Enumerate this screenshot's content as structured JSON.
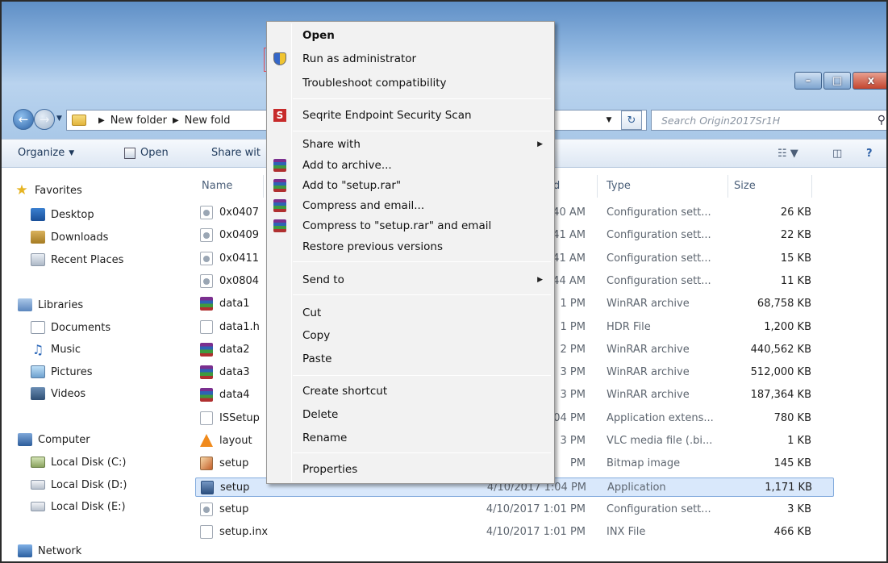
{
  "window": {
    "controls": {
      "minimize": "–",
      "maximize": "□",
      "close": "x"
    }
  },
  "address": {
    "crumbs": [
      "New folder",
      "New fold"
    ],
    "search_placeholder": "Search Origin2017Sr1H"
  },
  "toolbar": {
    "organize_label": "Organize",
    "open_label": "Open",
    "share_label": "Share wit"
  },
  "nav": {
    "favorites": "Favorites",
    "desktop": "Desktop",
    "downloads": "Downloads",
    "recent": "Recent Places",
    "libraries": "Libraries",
    "documents": "Documents",
    "music": "Music",
    "pictures": "Pictures",
    "videos": "Videos",
    "computer": "Computer",
    "disk_c": "Local Disk (C:)",
    "disk_d": "Local Disk (D:)",
    "disk_e": "Local Disk (E:)",
    "network": "Network"
  },
  "columns": {
    "name": "Name",
    "date_fragment": "d",
    "type": "Type",
    "size": "Size"
  },
  "files": [
    {
      "name": "0x0407",
      "date": "40 AM",
      "type": "Configuration sett...",
      "size": "26 KB",
      "icon": "config-icon"
    },
    {
      "name": "0x0409",
      "date": "41 AM",
      "type": "Configuration sett...",
      "size": "22 KB",
      "icon": "config-icon"
    },
    {
      "name": "0x0411",
      "date": "41 AM",
      "type": "Configuration sett...",
      "size": "15 KB",
      "icon": "config-icon"
    },
    {
      "name": "0x0804",
      "date": "44 AM",
      "type": "Configuration sett...",
      "size": "11 KB",
      "icon": "config-icon"
    },
    {
      "name": "data1",
      "date": "1 PM",
      "type": "WinRAR archive",
      "size": "68,758 KB",
      "icon": "winrar-icon"
    },
    {
      "name": "data1.h",
      "date": "1 PM",
      "type": "HDR File",
      "size": "1,200 KB",
      "icon": "blank-file-icon"
    },
    {
      "name": "data2",
      "date": "2 PM",
      "type": "WinRAR archive",
      "size": "440,562 KB",
      "icon": "winrar-icon"
    },
    {
      "name": "data3",
      "date": "3 PM",
      "type": "WinRAR archive",
      "size": "512,000 KB",
      "icon": "winrar-icon"
    },
    {
      "name": "data4",
      "date": "3 PM",
      "type": "WinRAR archive",
      "size": "187,364 KB",
      "icon": "winrar-icon"
    },
    {
      "name": "ISSetup",
      "date": "04 PM",
      "type": "Application extens...",
      "size": "780 KB",
      "icon": "dll-icon"
    },
    {
      "name": "layout",
      "date": "3 PM",
      "type": "VLC media file (.bi...",
      "size": "1 KB",
      "icon": "vlc-icon"
    },
    {
      "name": "setup",
      "date": "PM",
      "type": "Bitmap image",
      "size": "145 KB",
      "icon": "bitmap-icon"
    },
    {
      "name": "setup",
      "date": "4/10/2017 1:04 PM",
      "type": "Application",
      "size": "1,171 KB",
      "icon": "application-icon",
      "selected": true
    },
    {
      "name": "setup",
      "date": "4/10/2017 1:01 PM",
      "type": "Configuration sett...",
      "size": "3 KB",
      "icon": "config-icon"
    },
    {
      "name": "setup.inx",
      "date": "4/10/2017 1:01 PM",
      "type": "INX File",
      "size": "466 KB",
      "icon": "blank-file-icon"
    }
  ],
  "context_menu": {
    "open": "Open",
    "run_as_admin": "Run as administrator",
    "troubleshoot": "Troubleshoot compatibility",
    "seqrite": "Seqrite Endpoint Security Scan",
    "share_with": "Share with",
    "add_archive": "Add to archive...",
    "add_setup_rar": "Add to \"setup.rar\"",
    "compress_email": "Compress and email...",
    "compress_setup_email": "Compress to \"setup.rar\" and email",
    "restore": "Restore previous versions",
    "send_to": "Send to",
    "cut": "Cut",
    "copy": "Copy",
    "paste": "Paste",
    "create_shortcut": "Create shortcut",
    "delete": "Delete",
    "rename": "Rename",
    "properties": "Properties"
  },
  "colors": {
    "highlight_box": "#e04b55",
    "selection": "#d9e8fb"
  }
}
